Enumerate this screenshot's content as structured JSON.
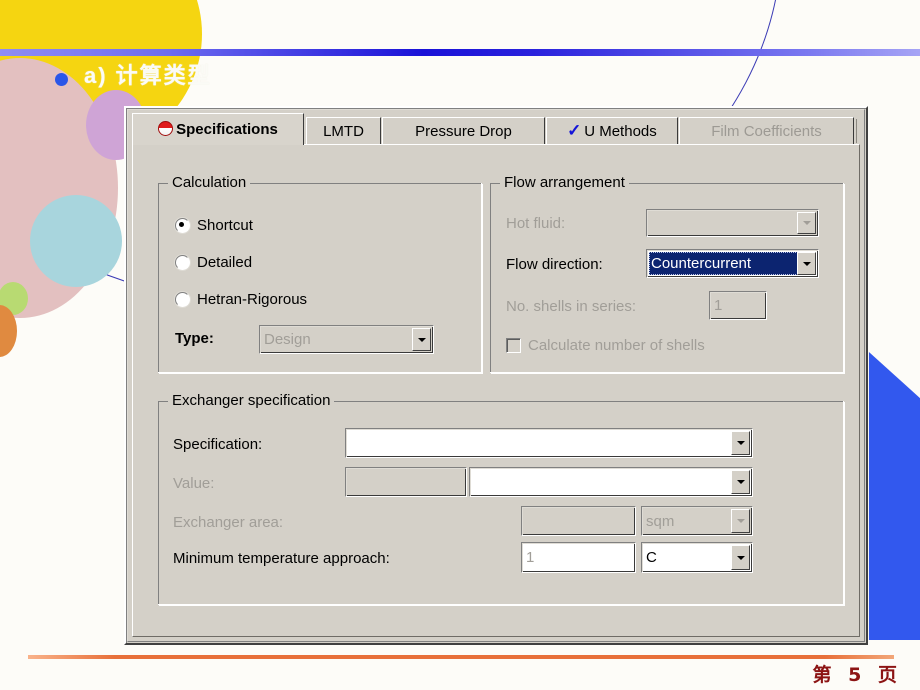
{
  "slide": {
    "title": "a) 计算类型",
    "page_label": "第 5 页"
  },
  "dialog": {
    "tabs": [
      {
        "label": "Specifications",
        "icon": "red-ball-icon",
        "state": "active"
      },
      {
        "label": "LMTD",
        "icon": "",
        "state": "normal"
      },
      {
        "label": "Pressure Drop",
        "icon": "",
        "state": "normal"
      },
      {
        "label": "U Methods",
        "icon": "blue-check-icon",
        "state": "normal"
      },
      {
        "label": "Film Coefficients",
        "icon": "",
        "state": "disabled"
      }
    ],
    "calculation": {
      "title": "Calculation",
      "radios": [
        {
          "label": "Shortcut",
          "selected": true
        },
        {
          "label": "Detailed",
          "selected": false
        },
        {
          "label": "Hetran-Rigorous",
          "selected": false
        }
      ],
      "type_label": "Type:",
      "type_value": "Design",
      "type_enabled": false
    },
    "flow_arrangement": {
      "title": "Flow arrangement",
      "hot_fluid_label": "Hot fluid:",
      "hot_fluid_value": "",
      "flow_direction_label": "Flow direction:",
      "flow_direction_value": "Countercurrent",
      "shells_label": "No. shells in series:",
      "shells_value": "1",
      "calc_shells_label": "Calculate number of shells",
      "calc_shells_checked": false
    },
    "exchanger_specification": {
      "title": "Exchanger specification",
      "specification_label": "Specification:",
      "specification_value": "",
      "value_label": "Value:",
      "value_number": "",
      "value_unit": "",
      "area_label": "Exchanger area:",
      "area_number": "",
      "area_unit": "sqm",
      "min_temp_label": "Minimum temperature approach:",
      "min_temp_number": "1",
      "min_temp_unit": "C"
    }
  },
  "colors": {
    "dialog_face": "#d4d0c8",
    "selection_blue": "#0c2470",
    "accent_blue": "#1a12d8",
    "accent_orange": "#e8703a",
    "page_number_red": "#8c1414",
    "tab_check_blue": "#1414d8",
    "tab_ball_red": "#e01c1c"
  }
}
